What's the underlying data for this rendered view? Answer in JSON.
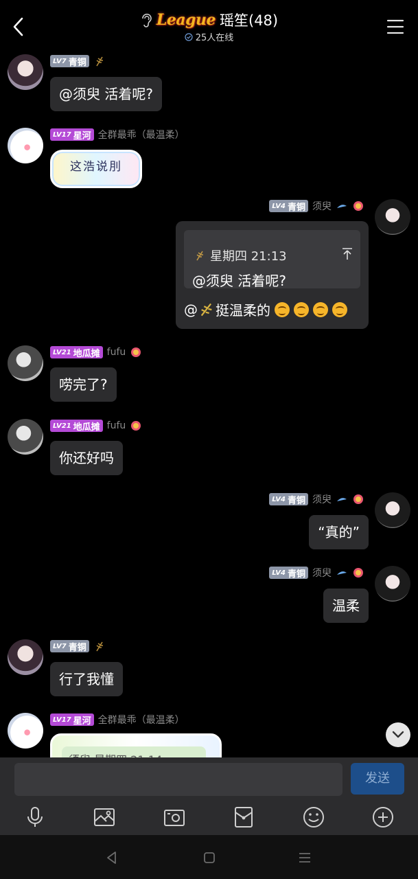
{
  "header": {
    "logo_text": "League",
    "group_name": "瑶笙(48)",
    "online": "25人在线"
  },
  "messages": [
    {
      "side": "left",
      "level": "LV7",
      "badge": "青铜",
      "badge_color": "#8d96a8",
      "name": "",
      "text": "@须臾 活着呢?"
    },
    {
      "side": "left",
      "level": "LV17",
      "badge": "星河",
      "badge_color": "#b44ad6",
      "name": "全群最乖（最温柔）",
      "sticker_text": "这浩说刖"
    },
    {
      "side": "right",
      "level": "LV4",
      "badge": "青铜",
      "badge_color": "#8d96a8",
      "name": "须臾",
      "quote_time": "星期四 21:13",
      "quote_text": "@须臾 活着呢?",
      "reply_text": "挺温柔的"
    },
    {
      "side": "left",
      "level": "LV21",
      "badge": "地瓜摊",
      "badge_color": "#b44ad6",
      "name": "fufu",
      "text": "唠完了?"
    },
    {
      "side": "left",
      "level": "LV21",
      "badge": "地瓜摊",
      "badge_color": "#b44ad6",
      "name": "fufu",
      "text": "你还好吗"
    },
    {
      "side": "right",
      "level": "LV4",
      "badge": "青铜",
      "badge_color": "#8d96a8",
      "name": "须臾",
      "text": "“真的”"
    },
    {
      "side": "right",
      "level": "LV4",
      "badge": "青铜",
      "badge_color": "#8d96a8",
      "name": "须臾",
      "text": "温柔"
    },
    {
      "side": "left",
      "level": "LV7",
      "badge": "青铜",
      "badge_color": "#8d96a8",
      "name": "",
      "text": "行了我懂"
    },
    {
      "side": "left",
      "level": "LV17",
      "badge": "星河",
      "badge_color": "#b44ad6",
      "name": "全群最乖（最温柔）",
      "partial_text": "须臾 星期四 21:14"
    }
  ],
  "input": {
    "placeholder": "",
    "send_label": "发送"
  },
  "toolbar": [
    "microphone-icon",
    "image-icon",
    "camera-icon",
    "red-packet-icon",
    "emoji-icon",
    "plus-icon"
  ],
  "nav": [
    "back-nav-icon",
    "home-nav-icon",
    "recents-nav-icon"
  ]
}
